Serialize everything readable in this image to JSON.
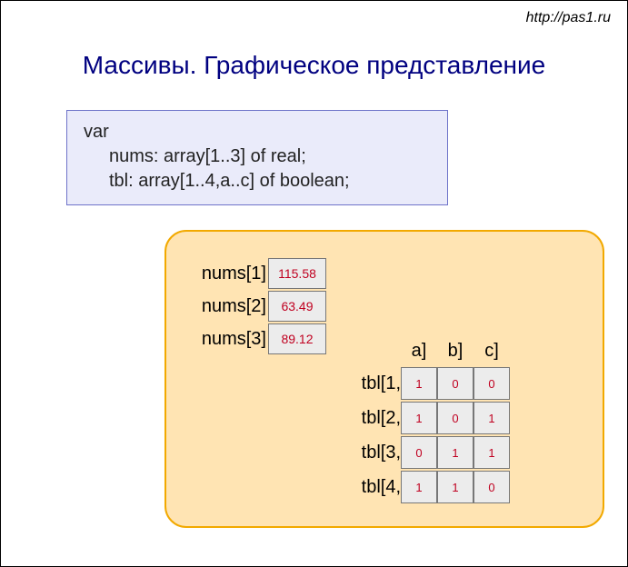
{
  "url": "http://pas1.ru",
  "title": "Массивы. Графическое представление",
  "code": {
    "line1": "var",
    "line2": "nums: array[1..3] of real;",
    "line3": "tbl: array[1..4,a..c] of boolean;"
  },
  "nums": {
    "labels": [
      "nums[1]",
      "nums[2]",
      "nums[3]"
    ],
    "values": [
      "115.58",
      "63.49",
      "89.12"
    ]
  },
  "tbl": {
    "col_headers": [
      "a]",
      "b]",
      "c]"
    ],
    "row_labels": [
      "tbl[1,",
      "tbl[2,",
      "tbl[3,",
      "tbl[4,"
    ],
    "cells": [
      [
        "1",
        "0",
        "0"
      ],
      [
        "1",
        "0",
        "1"
      ],
      [
        "0",
        "1",
        "1"
      ],
      [
        "1",
        "1",
        "0"
      ]
    ]
  }
}
